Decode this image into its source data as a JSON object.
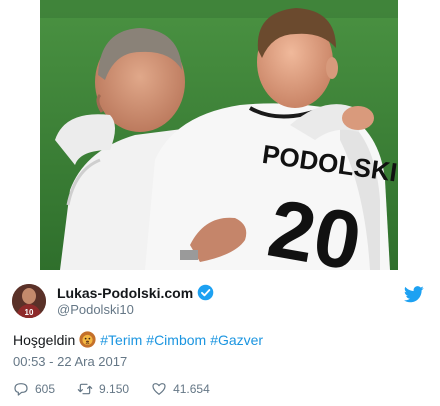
{
  "media": {
    "jersey_name": "PODOLSKI",
    "jersey_number": "20"
  },
  "header": {
    "display_name": "Lukas-Podolski.com",
    "handle": "@Podolski10",
    "verified_icon": "verified-badge-icon",
    "brand_icon": "twitter-bird-icon",
    "avatar_number": "10"
  },
  "tweet": {
    "text_prefix": "Hoşgeldin",
    "emoji": "lion-emoji",
    "hashtags": [
      "#Terim",
      "#Cimbom",
      "#Gazver"
    ],
    "timestamp": "00:53 - 22 Ara 2017"
  },
  "actions": {
    "replies": "605",
    "retweets": "9.150",
    "likes": "41.654"
  },
  "colors": {
    "link": "#1b95e0",
    "muted": "#657786",
    "text": "#14171a",
    "grass": "#3f8a3a"
  }
}
